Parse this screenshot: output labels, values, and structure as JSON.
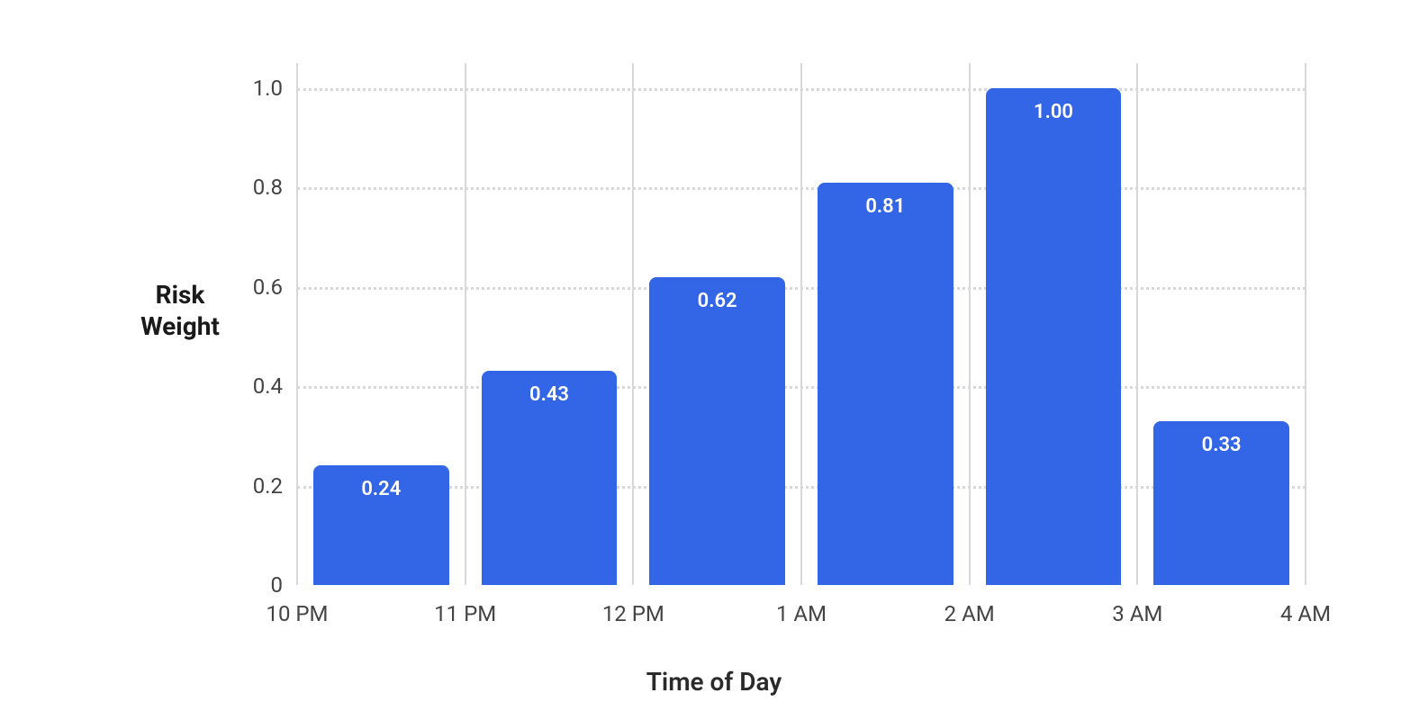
{
  "chart_data": {
    "type": "bar",
    "ylabel": "Risk\nWeight",
    "xlabel": "Time of Day",
    "y_ticks": [
      "0",
      "0.2",
      "0.4",
      "0.6",
      "0.8",
      "1.0"
    ],
    "x_ticks": [
      "10 PM",
      "11 PM",
      "12 PM",
      "1 AM",
      "2 AM",
      "3 AM",
      "4 AM"
    ],
    "categories": [
      "10 PM",
      "11 PM",
      "12 PM",
      "1 AM",
      "2 AM",
      "3 AM"
    ],
    "values": [
      0.24,
      0.43,
      0.62,
      0.81,
      1.0,
      0.33
    ],
    "value_labels": [
      "0.24",
      "0.43",
      "0.62",
      "0.81",
      "1.00",
      "0.33"
    ],
    "ylim": [
      0,
      1.05
    ],
    "bar_color": "#3366e6"
  }
}
